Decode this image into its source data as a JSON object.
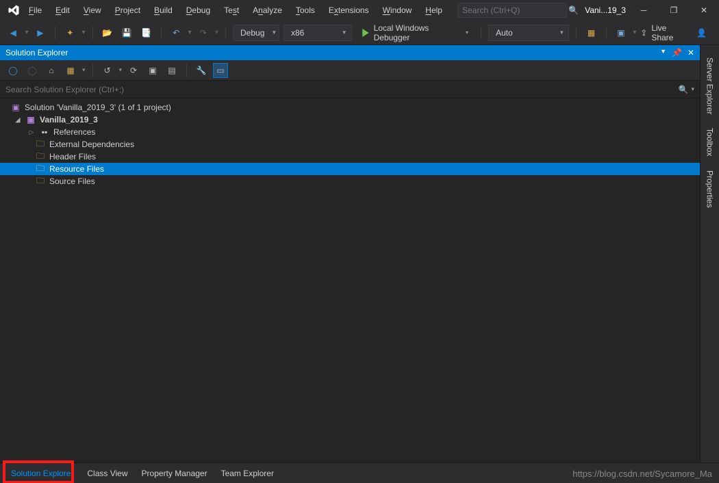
{
  "menu": {
    "file": "File",
    "edit": "Edit",
    "view": "View",
    "project": "Project",
    "build": "Build",
    "debug": "Debug",
    "test": "Test",
    "analyze": "Analyze",
    "tools": "Tools",
    "extensions": "Extensions",
    "window": "Window",
    "help": "Help"
  },
  "search": {
    "placeholder": "Search (Ctrl+Q)"
  },
  "project_title": "Vani...19_3",
  "toolbar": {
    "config": "Debug",
    "platform": "x86",
    "launch": "Local Windows Debugger",
    "auto": "Auto",
    "liveshare": "Live Share"
  },
  "pane": {
    "title": "Solution Explorer",
    "search_placeholder": "Search Solution Explorer (Ctrl+;)"
  },
  "tree": {
    "solution": "Solution 'Vanilla_2019_3' (1 of 1 project)",
    "project": "Vanilla_2019_3",
    "references": "References",
    "external": "External Dependencies",
    "header": "Header Files",
    "resource": "Resource Files",
    "source": "Source Files"
  },
  "sidetabs": {
    "server": "Server Explorer",
    "toolbox": "Toolbox",
    "properties": "Properties"
  },
  "bottom": {
    "solution": "Solution Explorer",
    "class": "Class View",
    "property": "Property Manager",
    "team": "Team Explorer"
  },
  "watermark": "https://blog.csdn.net/Sycamore_Ma"
}
